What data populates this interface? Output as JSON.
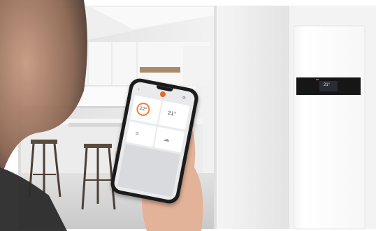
{
  "scene": {
    "description_icons": [
      "kitchen-background",
      "heat-pump",
      "smartphone",
      "hand",
      "person-silhouette"
    ]
  },
  "phone": {
    "zone_1_temperature": "22°",
    "zone_2_temperature": "21°",
    "menu_icon": "menu-icon",
    "weather_icon": "cloud-icon",
    "settings_icon": "gear-icon",
    "back_icon": "back-icon"
  },
  "heat_pump": {
    "display_temperature": "21°"
  },
  "colors": {
    "accent": "#f07d3a",
    "heat_pump_panel": "#161616",
    "wall": "#e9eaec"
  }
}
